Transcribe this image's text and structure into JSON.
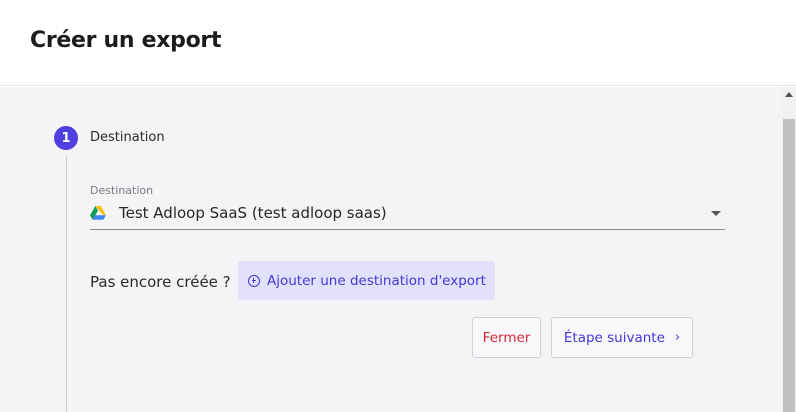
{
  "header": {
    "title": "Créer un export"
  },
  "step": {
    "number": "1",
    "label": "Destination"
  },
  "destination": {
    "field_label": "Destination",
    "value": "Test Adloop SaaS (test adloop saas)",
    "icon": "google-drive-icon"
  },
  "prompt": {
    "text": "Pas encore créée ?"
  },
  "add_destination": {
    "label": "Ajouter une destination d'export",
    "icon": "plus-circle-icon"
  },
  "actions": {
    "close_label": "Fermer",
    "next_label": "Étape suivante",
    "next_icon": "chevron-right-icon"
  },
  "colors": {
    "accent": "#4f3fe0",
    "danger": "#d3263a",
    "accent_soft": "#e3e0fb"
  }
}
